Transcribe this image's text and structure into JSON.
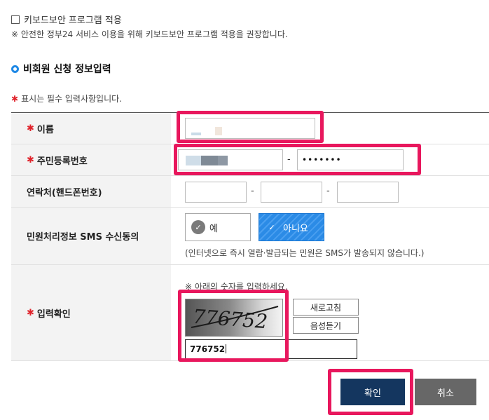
{
  "keyboard_security": {
    "checkbox_label": "키보드보안 프로그램 적용",
    "note": "※ 안전한 정부24 서비스 이용을 위해 키보드보안 프로그램 적용을 권장합니다.",
    "checked": false
  },
  "section": {
    "title": "비회원 신청 정보입력",
    "required_note": "표시는 필수 입력사항입니다."
  },
  "form": {
    "name_label": "이름",
    "rrn_label": "주민등록번호",
    "rrn_dash": "-",
    "rrn_back_value": "•••••••",
    "phone_label": "연락처(핸드폰번호)",
    "phone_dash": "-",
    "sms_label": "민원처리정보 SMS 수신동의",
    "sms_yes": "예",
    "sms_no": "아니요",
    "sms_selected": "아니요",
    "sms_note": "(인터넷으로 즉시 열람·발급되는 민원은 SMS가 발송되지 않습니다.)",
    "captcha_label": "입력확인",
    "captcha_note": "※ 아래의 숫자를 입력하세요.",
    "captcha_image_text": "776752",
    "captcha_refresh": "새로고침",
    "captcha_audio": "음성듣기",
    "captcha_value": "776752"
  },
  "actions": {
    "confirm": "확인",
    "cancel": "취소"
  },
  "colors": {
    "required_star": "#e0232b",
    "highlight": "#e8175d",
    "confirm_bg": "#14365f",
    "cancel_bg": "#676767",
    "selected_option": "#2b8be6"
  }
}
